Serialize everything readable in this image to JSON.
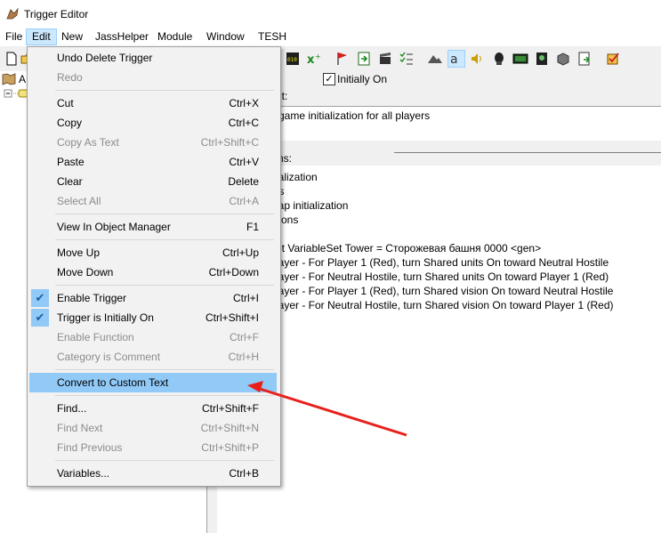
{
  "window": {
    "title": "Trigger Editor"
  },
  "menubar": {
    "items": [
      {
        "label": "File"
      },
      {
        "label": "Edit"
      },
      {
        "label": "New"
      },
      {
        "label": "JassHelper"
      },
      {
        "label": "Module"
      },
      {
        "label": "Window"
      },
      {
        "label": "TESH"
      }
    ]
  },
  "tree": {
    "root_label": "A"
  },
  "trigger": {
    "initially_on_label": "Initially On",
    "initially_on_checked": true,
    "comment_label": "nt:",
    "comment_text": "game initialization for all players",
    "functions_label": "ns:",
    "lines": [
      "ialization",
      "ts",
      "lap initialization",
      "tions",
      "et VariableSet Tower = Сторожевая башня 0000 <gen>",
      "layer - For Player 1 (Red), turn Shared units On toward Neutral Hostile",
      "layer - For Neutral Hostile, turn Shared units On toward Player 1 (Red)",
      "layer - For Player 1 (Red), turn Shared vision On toward Neutral Hostile",
      "layer - For Neutral Hostile, turn Shared vision On toward Player 1 (Red)"
    ]
  },
  "edit_menu": {
    "items": [
      {
        "label": "Undo Delete Trigger",
        "shortcut": "",
        "enabled": true
      },
      {
        "label": "Redo",
        "shortcut": "",
        "enabled": false
      },
      {
        "label": "Cut",
        "shortcut": "Ctrl+X",
        "enabled": true
      },
      {
        "label": "Copy",
        "shortcut": "Ctrl+C",
        "enabled": true
      },
      {
        "label": "Copy As Text",
        "shortcut": "Ctrl+Shift+C",
        "enabled": false
      },
      {
        "label": "Paste",
        "shortcut": "Ctrl+V",
        "enabled": true
      },
      {
        "label": "Clear",
        "shortcut": "Delete",
        "enabled": true
      },
      {
        "label": "Select All",
        "shortcut": "Ctrl+A",
        "enabled": false
      },
      {
        "label": "View In Object Manager",
        "shortcut": "F1",
        "enabled": true
      },
      {
        "label": "Move Up",
        "shortcut": "Ctrl+Up",
        "enabled": true
      },
      {
        "label": "Move Down",
        "shortcut": "Ctrl+Down",
        "enabled": true
      },
      {
        "label": "Enable Trigger",
        "shortcut": "Ctrl+I",
        "enabled": true,
        "checked": true
      },
      {
        "label": "Trigger is Initially On",
        "shortcut": "Ctrl+Shift+I",
        "enabled": true,
        "checked": true
      },
      {
        "label": "Enable Function",
        "shortcut": "Ctrl+F",
        "enabled": false
      },
      {
        "label": "Category is Comment",
        "shortcut": "Ctrl+H",
        "enabled": false
      },
      {
        "label": "Convert to Custom Text",
        "shortcut": "",
        "enabled": true,
        "highlighted": true
      },
      {
        "label": "Find...",
        "shortcut": "Ctrl+Shift+F",
        "enabled": true
      },
      {
        "label": "Find Next",
        "shortcut": "Ctrl+Shift+N",
        "enabled": false
      },
      {
        "label": "Find Previous",
        "shortcut": "Ctrl+Shift+P",
        "enabled": false
      },
      {
        "label": "Variables...",
        "shortcut": "Ctrl+B",
        "enabled": true
      }
    ]
  },
  "colors": {
    "highlight": "#91c9f7",
    "arrow": "#e8201c",
    "disabled_text": "#8c8c8c"
  }
}
